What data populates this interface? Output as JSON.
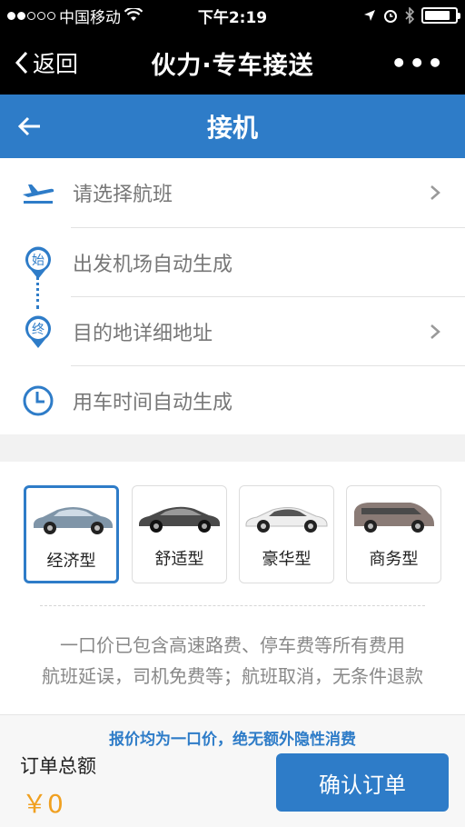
{
  "status_bar": {
    "carrier": "中国移动",
    "time": "下午2:19",
    "battery_level": 0.85
  },
  "nav": {
    "back_label": "返回",
    "title": "伙力·专车接送",
    "more": "•••"
  },
  "header": {
    "title": "接机"
  },
  "form": {
    "rows": [
      {
        "icon": "plane-icon",
        "label": "请选择航班",
        "has_chevron": true
      },
      {
        "icon": "start-marker-icon",
        "marker_text": "始",
        "label": "出发机场自动生成",
        "has_chevron": false
      },
      {
        "icon": "end-marker-icon",
        "marker_text": "终",
        "label": "目的地详细地址",
        "has_chevron": true
      },
      {
        "icon": "clock-icon",
        "label": "用车时间自动生成",
        "has_chevron": false
      }
    ]
  },
  "car_types": {
    "options": [
      {
        "label": "经济型",
        "selected": true,
        "color": "#7f95a8"
      },
      {
        "label": "舒适型",
        "selected": false,
        "color": "#4a4a4a"
      },
      {
        "label": "豪华型",
        "selected": false,
        "color": "#eeeeee"
      },
      {
        "label": "商务型",
        "selected": false,
        "color": "#8a7b76"
      }
    ],
    "notes": [
      "一口价已包含高速路费、停车费等所有费用",
      "航班延误，司机免费等；航班取消，无条件退款"
    ]
  },
  "footer": {
    "promo": "报价均为一口价，绝无额外隐性消费",
    "total_label": "订单总额",
    "total_value": "￥0",
    "confirm_label": "确认订单"
  },
  "colors": {
    "accent": "#2e7cc8",
    "price": "#f0a020"
  }
}
